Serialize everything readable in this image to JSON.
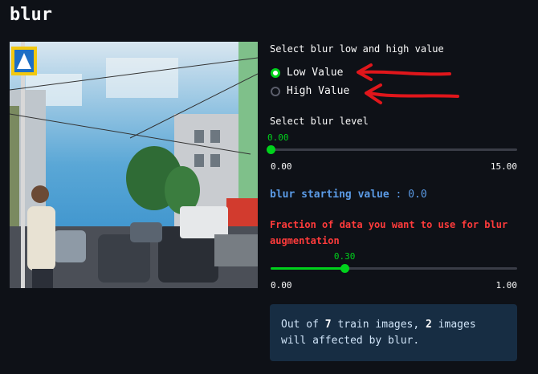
{
  "page": {
    "title": "blur"
  },
  "radio": {
    "prompt": "Select blur low and high value",
    "options": [
      {
        "label": "Low Value",
        "selected": true
      },
      {
        "label": "High Value",
        "selected": false
      }
    ]
  },
  "level_slider": {
    "label": "Select blur level",
    "value": "0.00",
    "min": "0.00",
    "max": "15.00",
    "fraction": 0.0
  },
  "starting": {
    "key": "blur starting value",
    "sep": " : ",
    "value": "0.0"
  },
  "fraction_label": "Fraction of data you want to use for blur augmentation",
  "fraction_slider": {
    "value": "0.30",
    "min": "0.00",
    "max": "1.00",
    "fraction": 0.3
  },
  "info": {
    "p1": "Out of ",
    "train_count": "7",
    "p2": " train images, ",
    "affected_count": "2",
    "p3": " images will affected by blur."
  },
  "colors": {
    "accent": "#00d21c",
    "bg": "#0e1117",
    "info_bg": "#172d43",
    "warn": "#ff3b3b",
    "annotation": "#e0161b"
  }
}
